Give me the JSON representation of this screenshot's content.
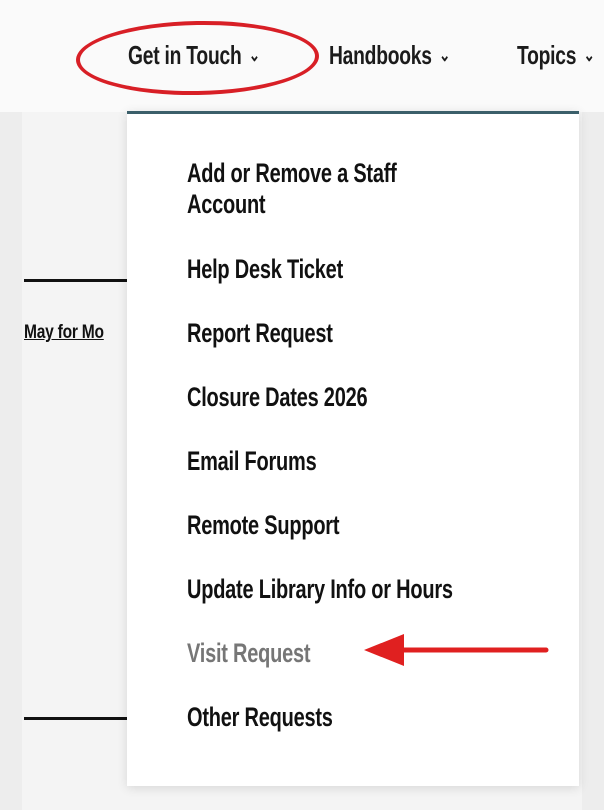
{
  "nav": {
    "items": [
      {
        "label": "Get in Touch",
        "chevron": "⌄"
      },
      {
        "label": "Handbooks",
        "chevron": "⌄"
      },
      {
        "label": "Topics",
        "chevron": "⌄"
      }
    ]
  },
  "content": {
    "link_text": "May for Mo"
  },
  "dropdown": {
    "items": [
      {
        "label_line1": "Add or Remove a Staff",
        "label_line2": "Account"
      },
      {
        "label": "Help Desk Ticket"
      },
      {
        "label": "Report Request"
      },
      {
        "label": "Closure Dates 2026"
      },
      {
        "label": "Email Forums"
      },
      {
        "label": "Remote Support"
      },
      {
        "label": "Update Library Info or Hours"
      },
      {
        "label": "Visit Request",
        "state": "hover"
      },
      {
        "label": "Other Requests"
      }
    ]
  },
  "annotations": {
    "oval_color": "#d81f26",
    "arrow_color": "#e02020"
  }
}
